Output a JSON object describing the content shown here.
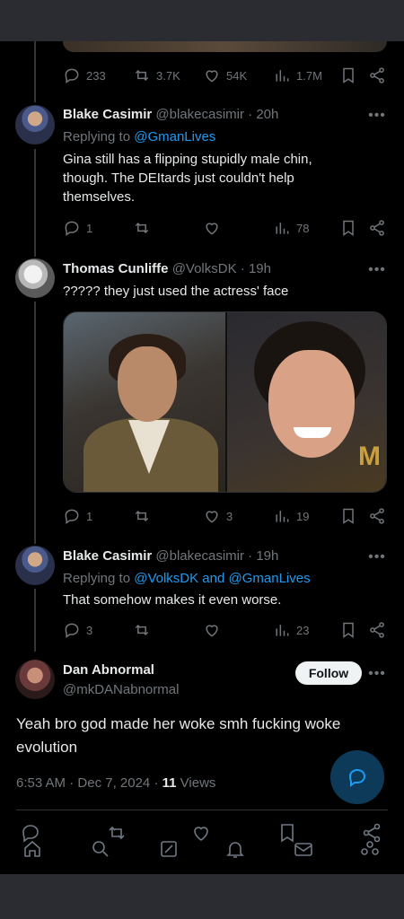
{
  "prev_tweet": {
    "actions": {
      "replies": "233",
      "reposts": "3.7K",
      "likes": "54K",
      "views": "1.7M"
    }
  },
  "replies": [
    {
      "name": "Blake Casimir",
      "handle": "@blakecasimir",
      "time": "20h",
      "replying_prefix": "Replying to ",
      "replying_mentions": "@GmanLives",
      "text": "Gina still has a flipping stupidly male chin, though. The DEItards just couldn't help themselves.",
      "actions": {
        "replies": "1",
        "reposts": "",
        "likes": "",
        "views": "78"
      }
    },
    {
      "name": "Thomas Cunliffe",
      "handle": "@VolksDK",
      "time": "19h",
      "text": "????? they just used the actress' face",
      "media_watermark": "M",
      "actions": {
        "replies": "1",
        "reposts": "",
        "likes": "3",
        "views": "19"
      }
    },
    {
      "name": "Blake Casimir",
      "handle": "@blakecasimir",
      "time": "19h",
      "replying_prefix": "Replying to ",
      "replying_mentions": "@VolksDK and @GmanLives",
      "text": "That somehow makes it even worse.",
      "actions": {
        "replies": "3",
        "reposts": "",
        "likes": "",
        "views": "23"
      }
    }
  ],
  "main_tweet": {
    "name": "Dan Abnormal",
    "handle": "@mkDANabnormal",
    "follow_label": "Follow",
    "text": "Yeah bro god made her woke smh fucking woke evolution",
    "time": "6:53 AM",
    "date": "Dec 7, 2024",
    "views_count": "11",
    "views_label": "Views"
  },
  "separators": {
    "dot": "·"
  },
  "icons": {
    "reply": "reply-icon",
    "repost": "repost-icon",
    "like": "heart-icon",
    "views": "views-icon",
    "bookmark": "bookmark-icon",
    "share": "share-icon",
    "more": "more-icon",
    "compose": "compose-icon"
  },
  "colors": {
    "accent": "#1d9bf0",
    "background": "#000000",
    "muted": "#71767b"
  }
}
